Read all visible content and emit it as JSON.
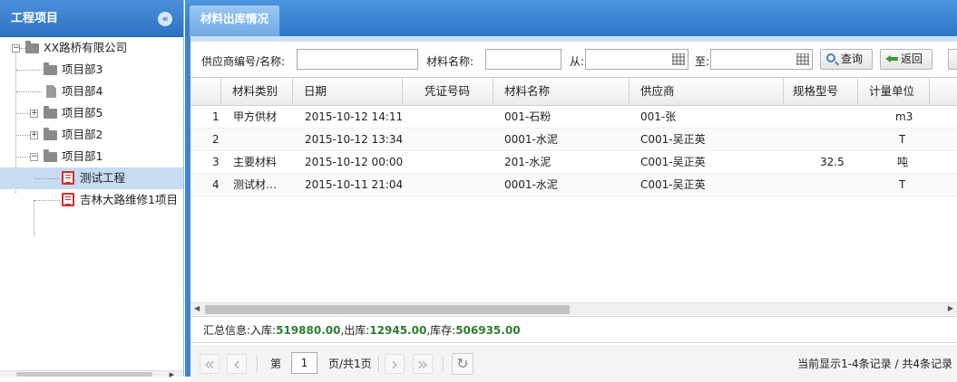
{
  "sidebar": {
    "title": "工程项目",
    "collapse_icon": "«",
    "root": "XX路桥有限公司",
    "items": [
      {
        "label": "项目部3"
      },
      {
        "label": "项目部4"
      },
      {
        "label": "项目部5"
      },
      {
        "label": "项目部2"
      },
      {
        "label": "项目部1"
      }
    ],
    "children": [
      {
        "label": "测试工程",
        "selected": true
      },
      {
        "label": "吉林大路维修1项目"
      }
    ]
  },
  "tab": {
    "label": "材料出库情况"
  },
  "toolbar": {
    "supplier_label": "供应商编号/名称:",
    "supplier_value": "",
    "material_label": "材料名称:",
    "material_value": "",
    "from_label": "从:",
    "to_label": "至:",
    "search_button": "查询",
    "back_button": "返回"
  },
  "grid": {
    "columns": [
      "材料类别",
      "日期",
      "凭证号码",
      "材料名称",
      "供应商",
      "规格型号",
      "计量单位"
    ],
    "rows": [
      {
        "num": "1",
        "category": "甲方供材",
        "date": "2015-10-12 14:11",
        "voucher": "",
        "material": "001-石粉",
        "supplier": "001-张",
        "spec": "",
        "unit": "m3"
      },
      {
        "num": "2",
        "category": "",
        "date": "2015-10-12 13:34",
        "voucher": "",
        "material": "0001-水泥",
        "supplier": "C001-吴正英",
        "spec": "",
        "unit": "T"
      },
      {
        "num": "3",
        "category": "主要材料",
        "date": "2015-10-12 00:00",
        "voucher": "",
        "material": "201-水泥",
        "supplier": "C001-吴正英",
        "spec": "32.5",
        "unit": "吨"
      },
      {
        "num": "4",
        "category": "测试材…",
        "date": "2015-10-11 21:04",
        "voucher": "",
        "material": "0001-水泥",
        "supplier": "C001-吴正英",
        "spec": "",
        "unit": "T"
      }
    ]
  },
  "summary": {
    "prefix": "汇总信息:入库:",
    "in_value": "519880.00",
    "out_label": ",出库:",
    "out_value": "12945.00",
    "stock_label": ",库存:",
    "stock_value": "506935.00"
  },
  "pager": {
    "page_prefix": "第",
    "page_value": "1",
    "page_suffix": "页/共1页",
    "info": "当前显示1-4条记录 / 共4条记录"
  }
}
